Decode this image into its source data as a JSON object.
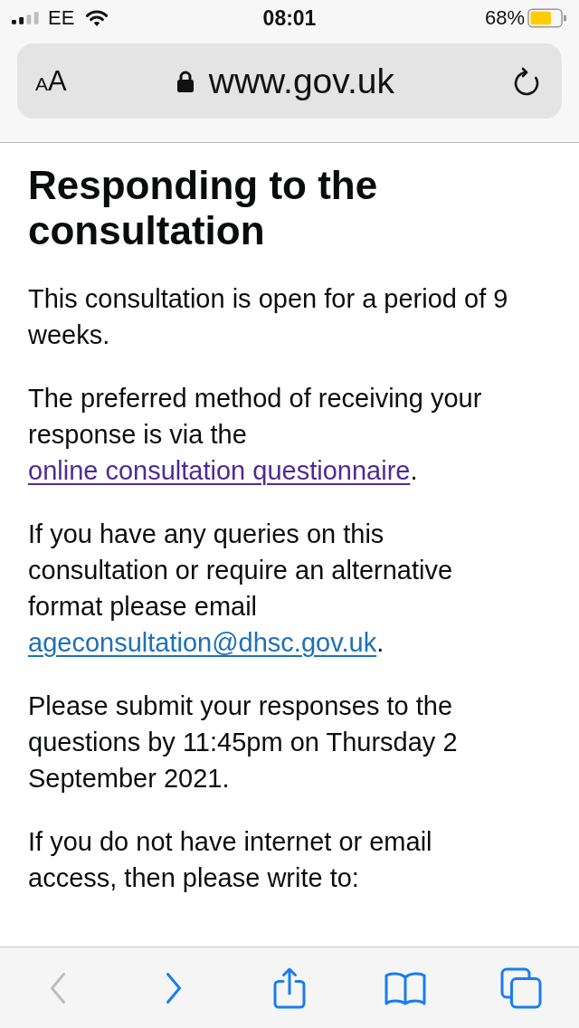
{
  "status_bar": {
    "carrier": "EE",
    "time": "08:01",
    "battery": "68%"
  },
  "address_bar": {
    "text_size_button": {
      "small_letter": "A",
      "large_letter": "A"
    },
    "url": "www.gov.uk"
  },
  "page": {
    "heading": "Responding to the consultation",
    "paragraphs": [
      {
        "parts": [
          {
            "kind": "text",
            "text": "This consultation is open for a period of 9 weeks."
          }
        ]
      },
      {
        "parts": [
          {
            "kind": "text",
            "text": "The preferred method of receiving your response is via the "
          },
          {
            "kind": "link",
            "text": "online consultation questionnaire",
            "visited": true
          },
          {
            "kind": "text",
            "text": "."
          }
        ]
      },
      {
        "parts": [
          {
            "kind": "text",
            "text": "If you have any queries on this consultation or require an alternative format please email "
          },
          {
            "kind": "link",
            "text": "ageconsultation@dhsc.gov.uk",
            "visited": false
          },
          {
            "kind": "text",
            "text": "."
          }
        ]
      },
      {
        "parts": [
          {
            "kind": "text",
            "text": "Please submit your responses to the questions by 11:45pm on Thursday 2 September 2021."
          }
        ]
      },
      {
        "parts": [
          {
            "kind": "text",
            "text": "If you do not have internet or email access, then please write to:"
          }
        ]
      }
    ]
  },
  "toolbar": {
    "buttons": [
      {
        "kind": "back",
        "disabled": true
      },
      {
        "kind": "forward",
        "disabled": false
      },
      {
        "kind": "share",
        "disabled": false
      },
      {
        "kind": "bookmarks",
        "disabled": false
      },
      {
        "kind": "tabs",
        "disabled": false
      }
    ]
  }
}
